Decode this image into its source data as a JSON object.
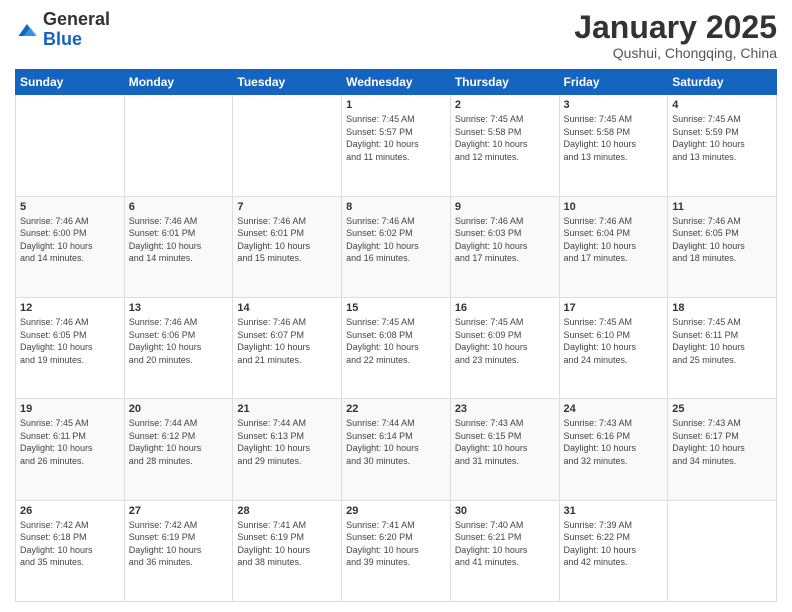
{
  "header": {
    "logo_general": "General",
    "logo_blue": "Blue",
    "month_title": "January 2025",
    "location": "Qushui, Chongqing, China"
  },
  "days_of_week": [
    "Sunday",
    "Monday",
    "Tuesday",
    "Wednesday",
    "Thursday",
    "Friday",
    "Saturday"
  ],
  "weeks": [
    [
      {
        "day": "",
        "detail": ""
      },
      {
        "day": "",
        "detail": ""
      },
      {
        "day": "",
        "detail": ""
      },
      {
        "day": "1",
        "detail": "Sunrise: 7:45 AM\nSunset: 5:57 PM\nDaylight: 10 hours\nand 11 minutes."
      },
      {
        "day": "2",
        "detail": "Sunrise: 7:45 AM\nSunset: 5:58 PM\nDaylight: 10 hours\nand 12 minutes."
      },
      {
        "day": "3",
        "detail": "Sunrise: 7:45 AM\nSunset: 5:58 PM\nDaylight: 10 hours\nand 13 minutes."
      },
      {
        "day": "4",
        "detail": "Sunrise: 7:45 AM\nSunset: 5:59 PM\nDaylight: 10 hours\nand 13 minutes."
      }
    ],
    [
      {
        "day": "5",
        "detail": "Sunrise: 7:46 AM\nSunset: 6:00 PM\nDaylight: 10 hours\nand 14 minutes."
      },
      {
        "day": "6",
        "detail": "Sunrise: 7:46 AM\nSunset: 6:01 PM\nDaylight: 10 hours\nand 14 minutes."
      },
      {
        "day": "7",
        "detail": "Sunrise: 7:46 AM\nSunset: 6:01 PM\nDaylight: 10 hours\nand 15 minutes."
      },
      {
        "day": "8",
        "detail": "Sunrise: 7:46 AM\nSunset: 6:02 PM\nDaylight: 10 hours\nand 16 minutes."
      },
      {
        "day": "9",
        "detail": "Sunrise: 7:46 AM\nSunset: 6:03 PM\nDaylight: 10 hours\nand 17 minutes."
      },
      {
        "day": "10",
        "detail": "Sunrise: 7:46 AM\nSunset: 6:04 PM\nDaylight: 10 hours\nand 17 minutes."
      },
      {
        "day": "11",
        "detail": "Sunrise: 7:46 AM\nSunset: 6:05 PM\nDaylight: 10 hours\nand 18 minutes."
      }
    ],
    [
      {
        "day": "12",
        "detail": "Sunrise: 7:46 AM\nSunset: 6:05 PM\nDaylight: 10 hours\nand 19 minutes."
      },
      {
        "day": "13",
        "detail": "Sunrise: 7:46 AM\nSunset: 6:06 PM\nDaylight: 10 hours\nand 20 minutes."
      },
      {
        "day": "14",
        "detail": "Sunrise: 7:46 AM\nSunset: 6:07 PM\nDaylight: 10 hours\nand 21 minutes."
      },
      {
        "day": "15",
        "detail": "Sunrise: 7:45 AM\nSunset: 6:08 PM\nDaylight: 10 hours\nand 22 minutes."
      },
      {
        "day": "16",
        "detail": "Sunrise: 7:45 AM\nSunset: 6:09 PM\nDaylight: 10 hours\nand 23 minutes."
      },
      {
        "day": "17",
        "detail": "Sunrise: 7:45 AM\nSunset: 6:10 PM\nDaylight: 10 hours\nand 24 minutes."
      },
      {
        "day": "18",
        "detail": "Sunrise: 7:45 AM\nSunset: 6:11 PM\nDaylight: 10 hours\nand 25 minutes."
      }
    ],
    [
      {
        "day": "19",
        "detail": "Sunrise: 7:45 AM\nSunset: 6:11 PM\nDaylight: 10 hours\nand 26 minutes."
      },
      {
        "day": "20",
        "detail": "Sunrise: 7:44 AM\nSunset: 6:12 PM\nDaylight: 10 hours\nand 28 minutes."
      },
      {
        "day": "21",
        "detail": "Sunrise: 7:44 AM\nSunset: 6:13 PM\nDaylight: 10 hours\nand 29 minutes."
      },
      {
        "day": "22",
        "detail": "Sunrise: 7:44 AM\nSunset: 6:14 PM\nDaylight: 10 hours\nand 30 minutes."
      },
      {
        "day": "23",
        "detail": "Sunrise: 7:43 AM\nSunset: 6:15 PM\nDaylight: 10 hours\nand 31 minutes."
      },
      {
        "day": "24",
        "detail": "Sunrise: 7:43 AM\nSunset: 6:16 PM\nDaylight: 10 hours\nand 32 minutes."
      },
      {
        "day": "25",
        "detail": "Sunrise: 7:43 AM\nSunset: 6:17 PM\nDaylight: 10 hours\nand 34 minutes."
      }
    ],
    [
      {
        "day": "26",
        "detail": "Sunrise: 7:42 AM\nSunset: 6:18 PM\nDaylight: 10 hours\nand 35 minutes."
      },
      {
        "day": "27",
        "detail": "Sunrise: 7:42 AM\nSunset: 6:19 PM\nDaylight: 10 hours\nand 36 minutes."
      },
      {
        "day": "28",
        "detail": "Sunrise: 7:41 AM\nSunset: 6:19 PM\nDaylight: 10 hours\nand 38 minutes."
      },
      {
        "day": "29",
        "detail": "Sunrise: 7:41 AM\nSunset: 6:20 PM\nDaylight: 10 hours\nand 39 minutes."
      },
      {
        "day": "30",
        "detail": "Sunrise: 7:40 AM\nSunset: 6:21 PM\nDaylight: 10 hours\nand 41 minutes."
      },
      {
        "day": "31",
        "detail": "Sunrise: 7:39 AM\nSunset: 6:22 PM\nDaylight: 10 hours\nand 42 minutes."
      },
      {
        "day": "",
        "detail": ""
      }
    ]
  ]
}
